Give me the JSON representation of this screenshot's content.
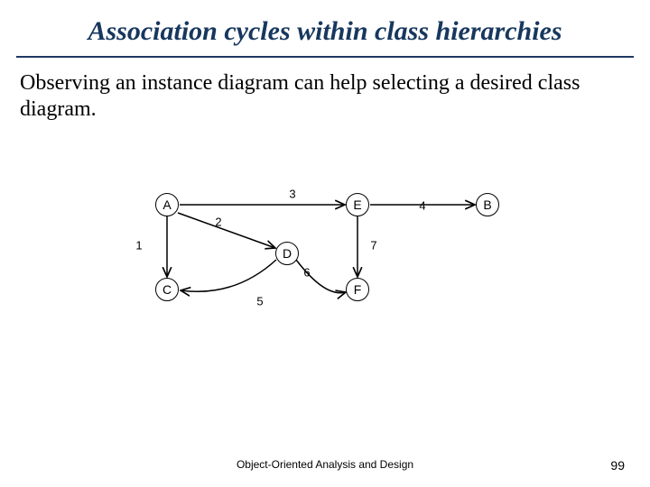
{
  "title": "Association cycles within class hierarchies",
  "body": "Observing an instance diagram can help selecting a desired class diagram.",
  "footer": "Object-Oriented Analysis and Design",
  "page": "99",
  "chart_data": {
    "type": "graph",
    "directed": true,
    "nodes": [
      {
        "id": "A",
        "label": "A"
      },
      {
        "id": "E",
        "label": "E"
      },
      {
        "id": "B",
        "label": "B"
      },
      {
        "id": "D",
        "label": "D"
      },
      {
        "id": "C",
        "label": "C"
      },
      {
        "id": "F",
        "label": "F"
      }
    ],
    "edges": [
      {
        "from": "A",
        "to": "C",
        "label": "1"
      },
      {
        "from": "A",
        "to": "D",
        "label": "2"
      },
      {
        "from": "A",
        "to": "E",
        "label": "3"
      },
      {
        "from": "E",
        "to": "B",
        "label": "4"
      },
      {
        "from": "D",
        "to": "C",
        "label": "5"
      },
      {
        "from": "D",
        "to": "F",
        "label": "6"
      },
      {
        "from": "E",
        "to": "F",
        "label": "7"
      }
    ]
  }
}
